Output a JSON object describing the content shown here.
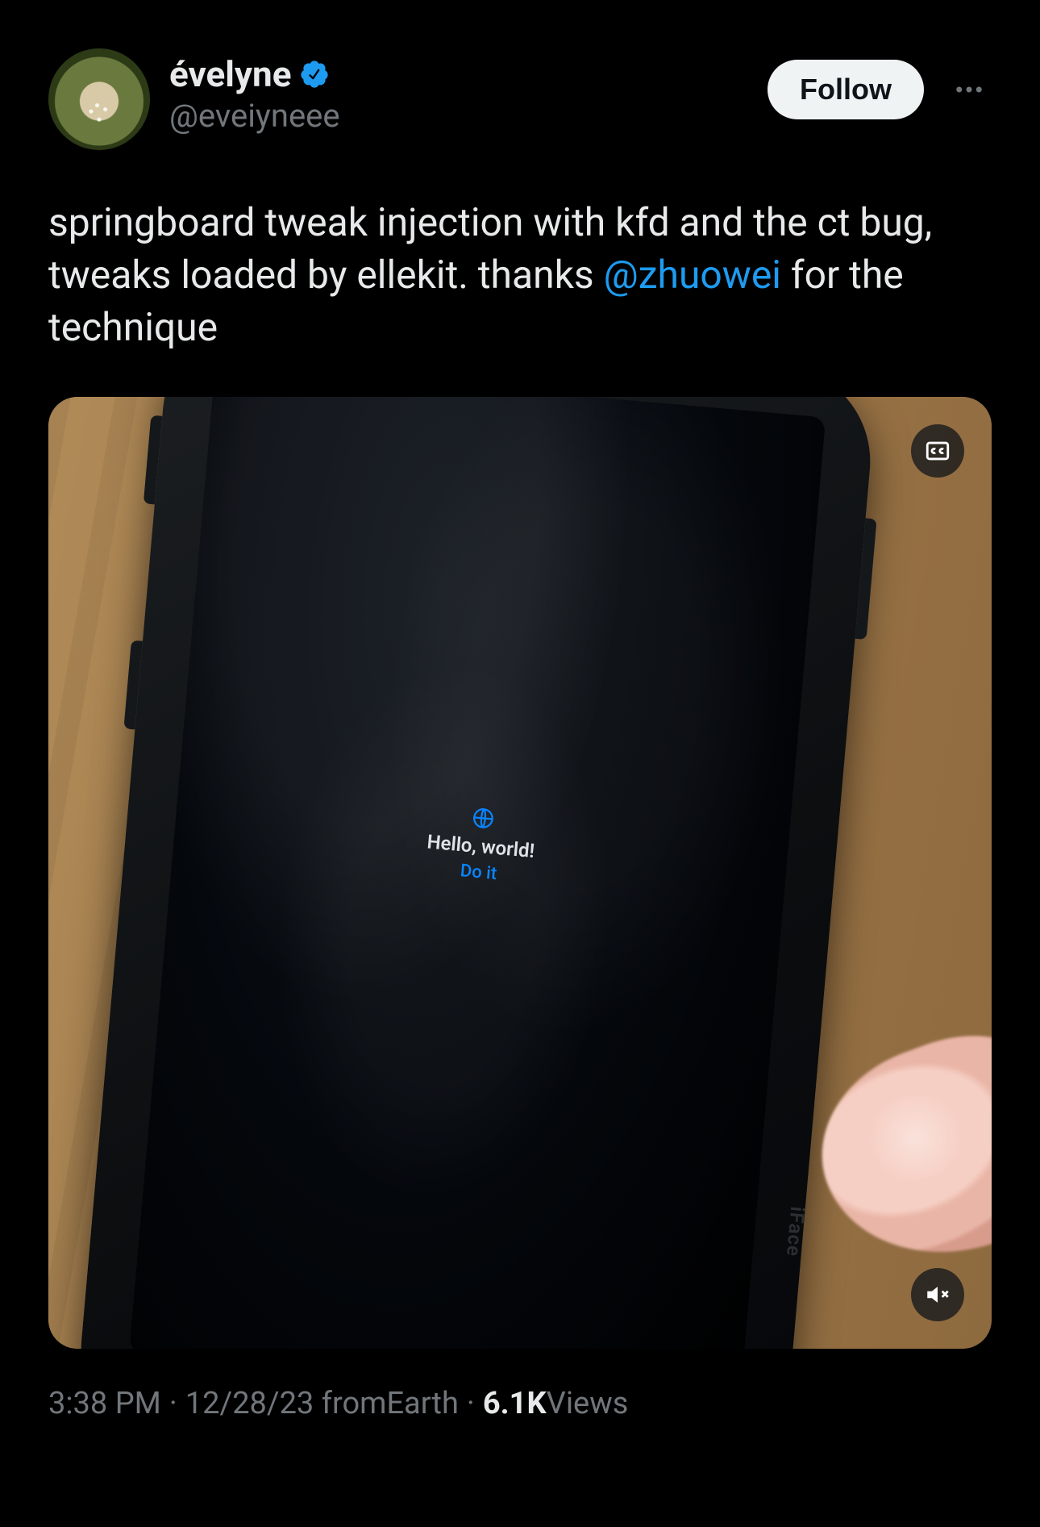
{
  "user": {
    "display_name": "évelyne",
    "handle": "@eveiyneee",
    "verified": true
  },
  "actions": {
    "follow_label": "Follow"
  },
  "tweet": {
    "text_before_mention": "springboard tweak injection with kfd and the ct bug, tweaks loaded by ellekit. thanks ",
    "mention": "@zhuowei",
    "text_after_mention": " for the technique"
  },
  "media": {
    "phone_screen": {
      "line1": "Hello, world!",
      "line2": "Do it"
    },
    "case_brand": "iFace"
  },
  "meta": {
    "time": "3:38 PM",
    "date": "12/28/23",
    "location_prefix": "from ",
    "location": "Earth",
    "views_count": "6.1K",
    "views_label": " Views"
  }
}
